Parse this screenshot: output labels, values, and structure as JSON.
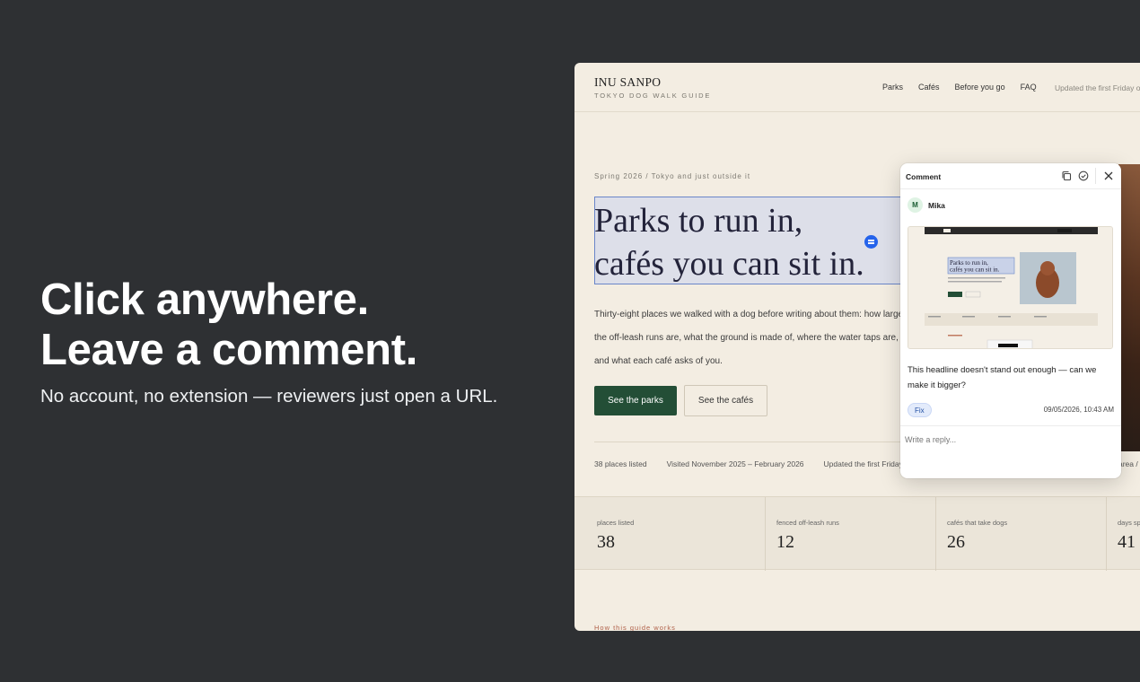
{
  "promo": {
    "headline_line1": "Click anywhere.",
    "headline_line2": "Leave a comment.",
    "subline": "No account, no extension — reviewers just open a URL."
  },
  "site": {
    "brand": "INU SANPO",
    "brand_sub": "TOKYO DOG WALK GUIDE",
    "nav": [
      "Parks",
      "Cafés",
      "Before you go",
      "FAQ"
    ],
    "nav_update": "Updated the first Friday of",
    "kicker": "Spring 2026 / Tokyo and just outside it",
    "headline_line1": "Parks to run in,",
    "headline_line2": "cafés you can sit in.",
    "body": "Thirty-eight places we walked with a dog before writing about them: how large the off-leash runs are, what the ground is made of, where the water taps are, and what each café asks of you.",
    "primary_button": "See the parks",
    "secondary_button": "See the cafés",
    "facts": [
      "38 places listed",
      "Visited November 2025 – February 2026",
      "Updated the first Friday m"
    ],
    "facts_right": "area /",
    "stats": [
      {
        "label": "places listed",
        "value": "38"
      },
      {
        "label": "fenced off-leash runs",
        "value": "12"
      },
      {
        "label": "cafés that take dogs",
        "value": "26"
      },
      {
        "label": "days sp",
        "value": "41"
      }
    ],
    "how": "How this guide works"
  },
  "comment_panel": {
    "title": "Comment",
    "author_initial": "M",
    "author": "Mika",
    "text": "This headline doesn't stand out enough — can we make it bigger?",
    "tag": "Fix",
    "timestamp": "09/05/2026, 10:43 AM",
    "reply_placeholder": "Write a reply..."
  },
  "icons": [
    "copy-icon",
    "check-circle-icon",
    "close-icon",
    "comment-pin-icon"
  ],
  "colors": {
    "background": "#2e3033",
    "page": "#f3ede2",
    "primary_button": "#234e36",
    "accent_blue": "#2563eb",
    "kicker_orange": "#b0614a"
  }
}
